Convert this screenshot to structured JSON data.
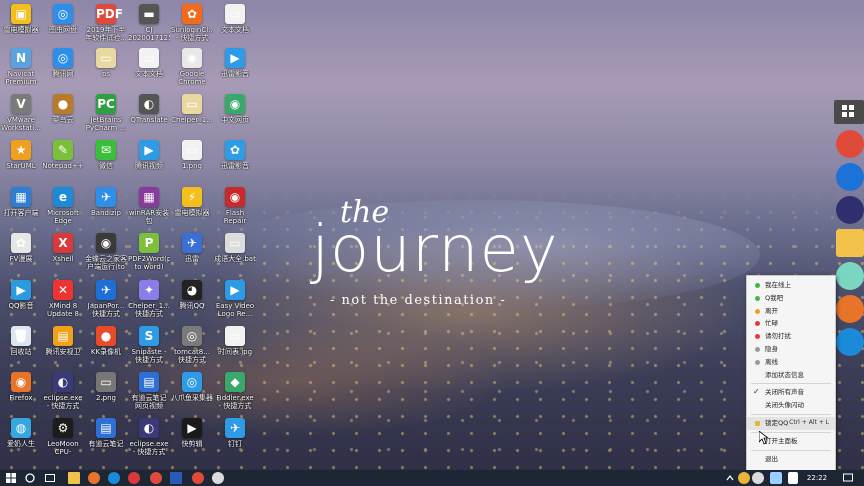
{
  "wallpaper": {
    "line1": "the",
    "line2": "journey",
    "line3": "- not the destination -"
  },
  "desktop_icons": [
    {
      "label": "此电脑",
      "color": "#3a8ee6",
      "glyph": "▣"
    },
    {
      "label": "Navicat Premium 12",
      "color": "#5aa2e0",
      "glyph": "N"
    },
    {
      "label": "VMware Workstati...",
      "color": "#7a7a7a",
      "glyph": "V"
    },
    {
      "label": "StarUML",
      "color": "#f0a020",
      "glyph": "★"
    },
    {
      "label": "打开客户端",
      "color": "#2d7fd3",
      "glyph": "▦"
    },
    {
      "label": "FV漫展",
      "color": "#e6e6e6",
      "glyph": "✿"
    },
    {
      "label": "QQ影音",
      "color": "#2a9be0",
      "glyph": "▶"
    },
    {
      "label": "回收站",
      "color": "#dde6ef",
      "glyph": "🗑"
    },
    {
      "label": "Firefox",
      "color": "#e8742a",
      "glyph": "◉"
    },
    {
      "label": "爱奶人生",
      "color": "#3aa6e0",
      "glyph": "◍"
    },
    {
      "label": "图虫网盘",
      "color": "#2f8fe8",
      "glyph": "◎"
    },
    {
      "label": "腾讯网",
      "color": "#2f8fe8",
      "glyph": "◎"
    },
    {
      "label": "菜鸟云",
      "color": "#b87b2a",
      "glyph": "●"
    },
    {
      "label": "Notepad++",
      "color": "#7bbf3a",
      "glyph": "✎"
    },
    {
      "label": "Microsoft Edge",
      "color": "#1b8ad8",
      "glyph": "e"
    },
    {
      "label": "Xshell",
      "color": "#d83a3a",
      "glyph": "X"
    },
    {
      "label": "XMind 8 Update 8",
      "color": "#e33",
      "glyph": "✕"
    },
    {
      "label": "腾讯安视卫",
      "color": "#f2a11a",
      "glyph": "▤"
    },
    {
      "label": "eclipse.exe - 快捷方式",
      "color": "#3b3a78",
      "glyph": "◐"
    },
    {
      "label": "LeoMoon CPU-V(cpu...",
      "color": "#1c1c1c",
      "glyph": "⚙"
    },
    {
      "label": "2019年下半年软件试验...",
      "color": "#e04a3a",
      "glyph": "PDF"
    },
    {
      "label": "ps",
      "color": "#e9d8a0",
      "glyph": "▭"
    },
    {
      "label": "JetBrains PyCharm ...",
      "color": "#2ea043",
      "glyph": "PC"
    },
    {
      "label": "微信",
      "color": "#3bbf3b",
      "glyph": "✉"
    },
    {
      "label": "Bandizip",
      "color": "#2f8fe8",
      "glyph": "✈"
    },
    {
      "label": "金蝶云之家客户端运行(to word)",
      "color": "#3a3a3a",
      "glyph": "◉"
    },
    {
      "label": "JapanPor... 快捷方式",
      "color": "#1d6fd3",
      "glyph": "✈"
    },
    {
      "label": "KK录像机",
      "color": "#e84a2a",
      "glyph": "●"
    },
    {
      "label": "2.png",
      "color": "#777",
      "glyph": "▭"
    },
    {
      "label": "有道云笔记",
      "color": "#2f6fd3",
      "glyph": "▤"
    },
    {
      "label": "CJ 2020017125...",
      "color": "#555",
      "glyph": "▬"
    },
    {
      "label": "文本文档",
      "color": "#f2f2f2",
      "glyph": "▭"
    },
    {
      "label": "QTranslate",
      "color": "#555",
      "glyph": "◐"
    },
    {
      "label": "腾讯视频",
      "color": "#2e9be6",
      "glyph": "▶"
    },
    {
      "label": "winRAR安装包",
      "color": "#8a3a9a",
      "glyph": "▦"
    },
    {
      "label": "PDF2Word(pdf to word)",
      "color": "#7bbf3a",
      "glyph": "P"
    },
    {
      "label": "Chelper_1... 快捷方式",
      "color": "#8a7de8",
      "glyph": "✦"
    },
    {
      "label": "Snipaste - 快捷方式",
      "color": "#2e9be6",
      "glyph": "S"
    },
    {
      "label": "有道云笔记 网页视频",
      "color": "#2f6fd3",
      "glyph": "▤"
    },
    {
      "label": "eclipse.exe - 快捷方式 (2)",
      "color": "#3b3a78",
      "glyph": "◐"
    },
    {
      "label": "SunloginCl... - 快捷方式",
      "color": "#f26a1a",
      "glyph": "✿"
    },
    {
      "label": "Google Chrome",
      "color": "#e8e8e8",
      "glyph": "◉"
    },
    {
      "label": "Chelper_1...",
      "color": "#e9d8a0",
      "glyph": "▭"
    },
    {
      "label": "1.png",
      "color": "#f2f2f2",
      "glyph": "▭"
    },
    {
      "label": "雷电模拟器",
      "color": "#f2c01a",
      "glyph": "⚡"
    },
    {
      "label": "迅雷",
      "color": "#3b6fd3",
      "glyph": "✈"
    },
    {
      "label": "腾讯QQ",
      "color": "#222",
      "glyph": "◕"
    },
    {
      "label": "tomcat8... 快捷方式",
      "color": "#7a7a7a",
      "glyph": "◎"
    },
    {
      "label": "八爪鱼采集器",
      "color": "#2e9be6",
      "glyph": "◎"
    },
    {
      "label": "快剪辑",
      "color": "#1a1a1a",
      "glyph": "▶"
    },
    {
      "label": "文本文档",
      "color": "#f2f2f2",
      "glyph": "▭"
    },
    {
      "label": "迅雷影音",
      "color": "#2e9be6",
      "glyph": "▶"
    },
    {
      "label": "中文网页",
      "color": "#3aa86a",
      "glyph": "◉"
    },
    {
      "label": "迅雷影音",
      "color": "#2e9be6",
      "glyph": "✿"
    },
    {
      "label": "Flash Repair",
      "color": "#c82a2a",
      "glyph": "◉"
    },
    {
      "label": "成语大全.bat",
      "color": "#dcdcdc",
      "glyph": "▭"
    },
    {
      "label": "Easy Video Logo Re...",
      "color": "#2e9be6",
      "glyph": "▶"
    },
    {
      "label": "时间表.jpg",
      "color": "#f2f2f2",
      "glyph": "▭"
    },
    {
      "label": "Fiddler.exe - 快捷方式",
      "color": "#3aa86a",
      "glyph": "◆"
    },
    {
      "label": "钉钉",
      "color": "#2e9be6",
      "glyph": "✈"
    },
    {
      "label": "雷电模拟器",
      "color": "#f2c01a",
      "glyph": "▣"
    }
  ],
  "dock": [
    {
      "name": "chrome",
      "color": "#e04a3a"
    },
    {
      "name": "kk",
      "color": "#1d72d8"
    },
    {
      "name": "eclipse",
      "color": "#2f2f6f"
    },
    {
      "name": "folder",
      "color": "#f2c24a"
    },
    {
      "name": "pinwheel",
      "color": "#7ad6c0"
    },
    {
      "name": "firefox",
      "color": "#e8742a"
    },
    {
      "name": "edge",
      "color": "#1b8ad8"
    }
  ],
  "qq_menu": {
    "items": [
      {
        "label": "我在线上",
        "dot": "#3dbb3d"
      },
      {
        "label": "Q我吧",
        "dot": "#3dbb3d"
      },
      {
        "label": "离开",
        "dot": "#f0a020"
      },
      {
        "label": "忙碌",
        "dot": "#e33b3b"
      },
      {
        "label": "请勿打扰",
        "dot": "#e33b3b"
      },
      {
        "label": "隐身",
        "dot": "#9a9a9a"
      },
      {
        "label": "离线",
        "dot": "#9a9a9a"
      },
      {
        "label": "添加状态信息",
        "dot": ""
      }
    ],
    "group2": [
      {
        "label": "关闭所有声音",
        "checked": true
      },
      {
        "label": "关闭头像闪动",
        "checked": false
      }
    ],
    "lock": {
      "label": "锁定QQ",
      "shortcut": "Ctrl + Alt + L"
    },
    "open_panel": "打开主面板",
    "exit": "退出"
  },
  "taskbar": {
    "time": "22:22"
  }
}
